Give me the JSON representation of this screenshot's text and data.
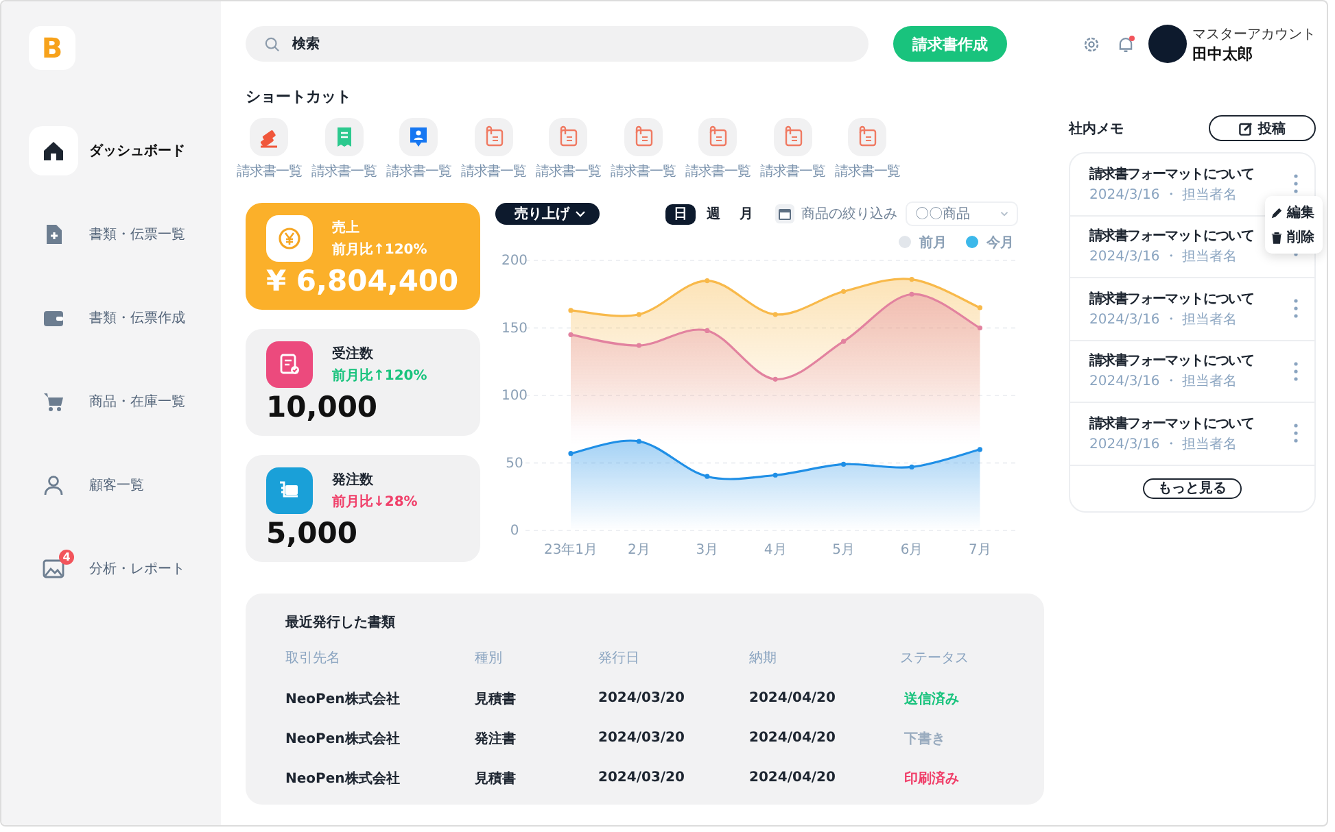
{
  "logo": {
    "text": "B"
  },
  "sidebar": {
    "items": [
      {
        "label": "ダッシュボード",
        "selected": true
      },
      {
        "label": "書類・伝票一覧",
        "selected": false
      },
      {
        "label": "書類・伝票作成",
        "selected": false
      },
      {
        "label": "商品・在庫一覧",
        "selected": false
      },
      {
        "label": "顧客一覧",
        "selected": false
      },
      {
        "label": "分析・レポート",
        "selected": false,
        "badge": "4"
      }
    ]
  },
  "search": {
    "placeholder": "検索"
  },
  "create_button": "請求書作成",
  "notifications": {
    "unread": true
  },
  "account": {
    "role": "マスターアカウント",
    "name": "田中太郎"
  },
  "shortcuts": {
    "title": "ショートカット",
    "items": [
      {
        "label": "請求書一覧"
      },
      {
        "label": "請求書一覧"
      },
      {
        "label": "請求書一覧"
      },
      {
        "label": "請求書一覧"
      },
      {
        "label": "請求書一覧"
      },
      {
        "label": "請求書一覧"
      },
      {
        "label": "請求書一覧"
      },
      {
        "label": "請求書一覧"
      },
      {
        "label": "請求書一覧"
      }
    ]
  },
  "stats": [
    {
      "title": "売上",
      "comparison": {
        "text": "前月比↑120%",
        "color": "#ffffff"
      },
      "value": "¥ 6,804,400",
      "highlighted": true,
      "color": "#ffffff"
    },
    {
      "title": "受注数",
      "comparison": {
        "text": "前月比↑120%",
        "color": "#19c37d"
      },
      "value": "10,000",
      "highlighted": false,
      "color": "#ec4a7d"
    },
    {
      "title": "発注数",
      "comparison": {
        "text": "前月比↓28%",
        "color": "#f0406a"
      },
      "value": "5,000",
      "highlighted": false,
      "color": "#1aa0d8"
    }
  ],
  "chart": {
    "metric_dropdown": "売り上げ",
    "periods": [
      {
        "label": "日",
        "selected": true
      },
      {
        "label": "週",
        "selected": false
      },
      {
        "label": "月",
        "selected": false
      }
    ],
    "filter_label": "商品の絞り込み",
    "product_select": {
      "value": "〇〇商品"
    },
    "legend": [
      {
        "label": "前月",
        "color": "#e2e6eb"
      },
      {
        "label": "今月",
        "color": "#3cb8ea"
      }
    ],
    "chart_data": {
      "type": "area",
      "categories": [
        "23年1月",
        "2月",
        "3月",
        "4月",
        "5月",
        "6月",
        "7月"
      ],
      "yticks": [
        0,
        50,
        100,
        150,
        200
      ],
      "ylim": [
        0,
        200
      ],
      "grid": true,
      "series": [
        {
          "color": "#f8b94a",
          "values": [
            163,
            160,
            185,
            160,
            177,
            186,
            165
          ]
        },
        {
          "color": "#e2829f",
          "values": [
            145,
            137,
            148,
            112,
            140,
            175,
            150
          ]
        },
        {
          "color": "#1f8fe6",
          "values": [
            57,
            66,
            40,
            41,
            49,
            47,
            60
          ]
        }
      ]
    }
  },
  "memo": {
    "title": "社内メモ",
    "post_button": "投稿",
    "items": [
      {
        "title": "請求書フォーマットについて",
        "meta": "2024/3/16 ・ 担当者名",
        "menu_open": true
      },
      {
        "title": "請求書フォーマットについて",
        "meta": "2024/3/16 ・ 担当者名",
        "menu_open": false
      },
      {
        "title": "請求書フォーマットについて",
        "meta": "2024/3/16 ・ 担当者名",
        "menu_open": false
      },
      {
        "title": "請求書フォーマットについて",
        "meta": "2024/3/16 ・ 担当者名",
        "menu_open": false
      },
      {
        "title": "請求書フォーマットについて",
        "meta": "2024/3/16 ・ 担当者名",
        "menu_open": false
      }
    ],
    "menu": [
      {
        "label": "編集"
      },
      {
        "label": "削除"
      }
    ],
    "more_button": "もっと見る"
  },
  "recent_docs": {
    "title": "最近発行した書類",
    "columns": [
      "取引先名",
      "種別",
      "発行日",
      "納期",
      "ステータス"
    ],
    "rows": [
      {
        "client": "NeoPen株式会社",
        "type": "見積書",
        "issued": "2024/03/20",
        "due": "2024/04/20",
        "status": "送信済み",
        "color": "#19c37d"
      },
      {
        "client": "NeoPen株式会社",
        "type": "発注書",
        "issued": "2024/03/20",
        "due": "2024/04/20",
        "status": "下書き",
        "color": "#9aacbf"
      },
      {
        "client": "NeoPen株式会社",
        "type": "見積書",
        "issued": "2024/03/20",
        "due": "2024/04/20",
        "status": "印刷済み",
        "color": "#f0406a"
      }
    ]
  }
}
